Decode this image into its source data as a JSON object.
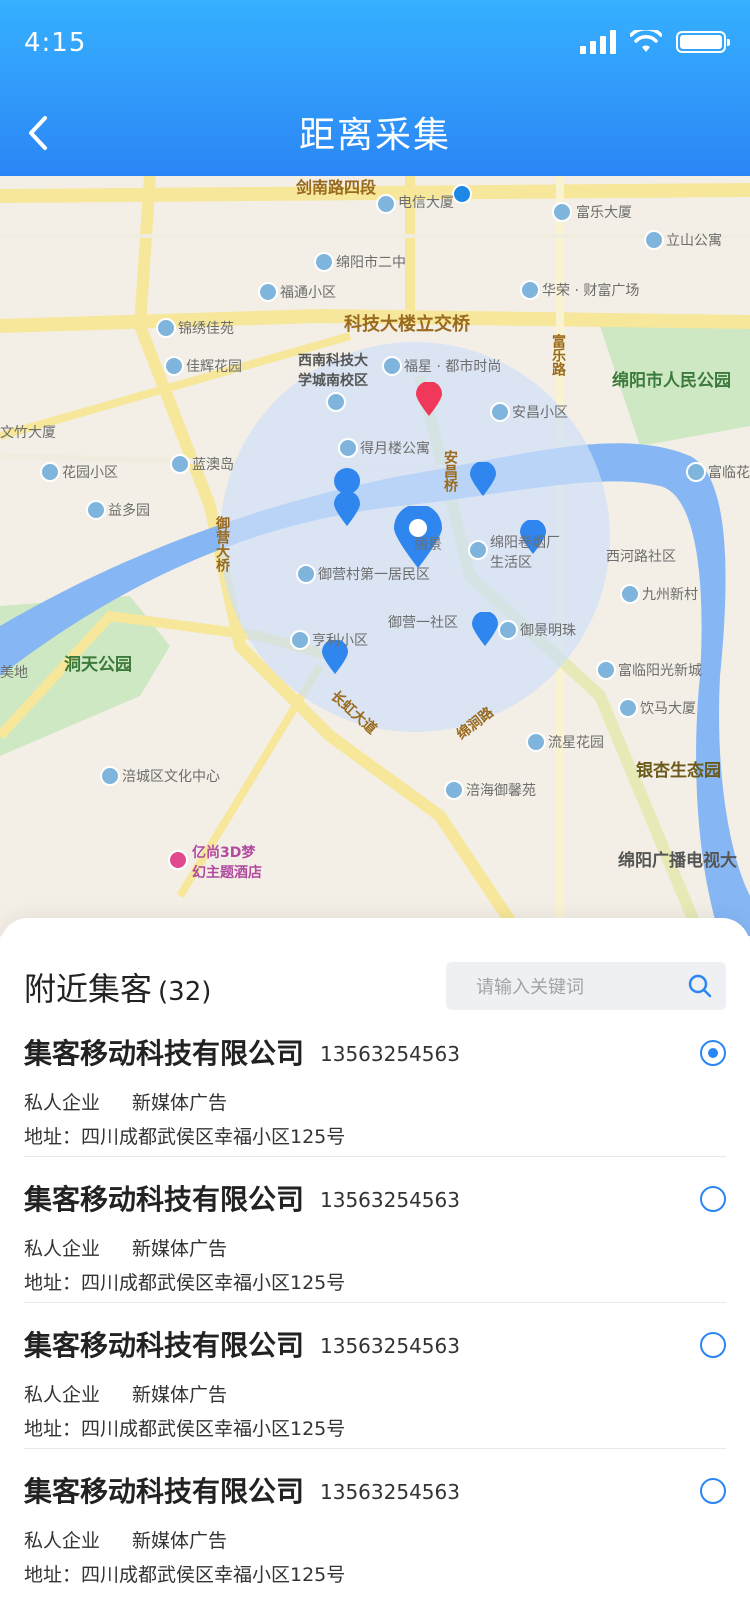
{
  "status": {
    "time": "4:15"
  },
  "header": {
    "title": "距离采集"
  },
  "map": {
    "labels": {
      "road1": "剑南路四段",
      "telecom": "电信大厦",
      "fule": "富乐大厦",
      "school2": "绵阳市二中",
      "lishan": "立山公寓",
      "futong": "福通小区",
      "huarong": "华荣 · 财富广场",
      "jinxiu": "锦绣佳苑",
      "overpass": "科技大楼立交桥",
      "jiahui": "佳辉花园",
      "swust": "西南科技大学城南校区",
      "fuxing": "福星 · 都市时尚",
      "fulerd": "富乐路",
      "park": "绵阳市人民公园",
      "wenzhu": "文竹大厦",
      "anchang": "安昌小区",
      "deyue": "得月楼公寓",
      "huayuan": "花园小区",
      "lanyu": "蓝澳岛",
      "anchangqiao": "安昌桥",
      "fuling": "富临花",
      "yiduo": "益多园",
      "yuying": "御营大桥",
      "lijing": "丽景",
      "juyan": "绵阳卷烟厂生活区",
      "xihe": "西河路社区",
      "yuyingcun": "御营村第一居民区",
      "jiuzhou": "九州新村",
      "hengli": "亨利小区",
      "yuying1": "御营一社区",
      "yujing": "御景明珠",
      "dongtian": "洞天公园",
      "meidi": "美地",
      "fulinyang": "富临阳光新城",
      "yinma": "饮马大厦",
      "changhong": "长虹大道",
      "mianjian": "绵涧路",
      "liuxing": "流星花园",
      "ginkgo": "银杏生态园",
      "fucheng": "涪城区文化中心",
      "fuhai": "涪海御馨苑",
      "hotel": "亿尚3D梦幻主题酒店",
      "tv": "绵阳广播电视大"
    }
  },
  "list": {
    "title": "附近集客",
    "count": "(32)",
    "search_placeholder": "请输入关键词",
    "items": [
      {
        "name": "集客移动科技有限公司",
        "phone": "13563254563",
        "type": "私人企业",
        "industry": "新媒体广告",
        "address": "地址：四川成都武侯区幸福小区125号",
        "selected": true
      },
      {
        "name": "集客移动科技有限公司",
        "phone": "13563254563",
        "type": "私人企业",
        "industry": "新媒体广告",
        "address": "地址：四川成都武侯区幸福小区125号",
        "selected": false
      },
      {
        "name": "集客移动科技有限公司",
        "phone": "13563254563",
        "type": "私人企业",
        "industry": "新媒体广告",
        "address": "地址：四川成都武侯区幸福小区125号",
        "selected": false
      },
      {
        "name": "集客移动科技有限公司",
        "phone": "13563254563",
        "type": "私人企业",
        "industry": "新媒体广告",
        "address": "地址：四川成都武侯区幸福小区125号",
        "selected": false
      }
    ]
  },
  "colors": {
    "primary": "#2b86f5",
    "header_top": "#36b0ff"
  }
}
